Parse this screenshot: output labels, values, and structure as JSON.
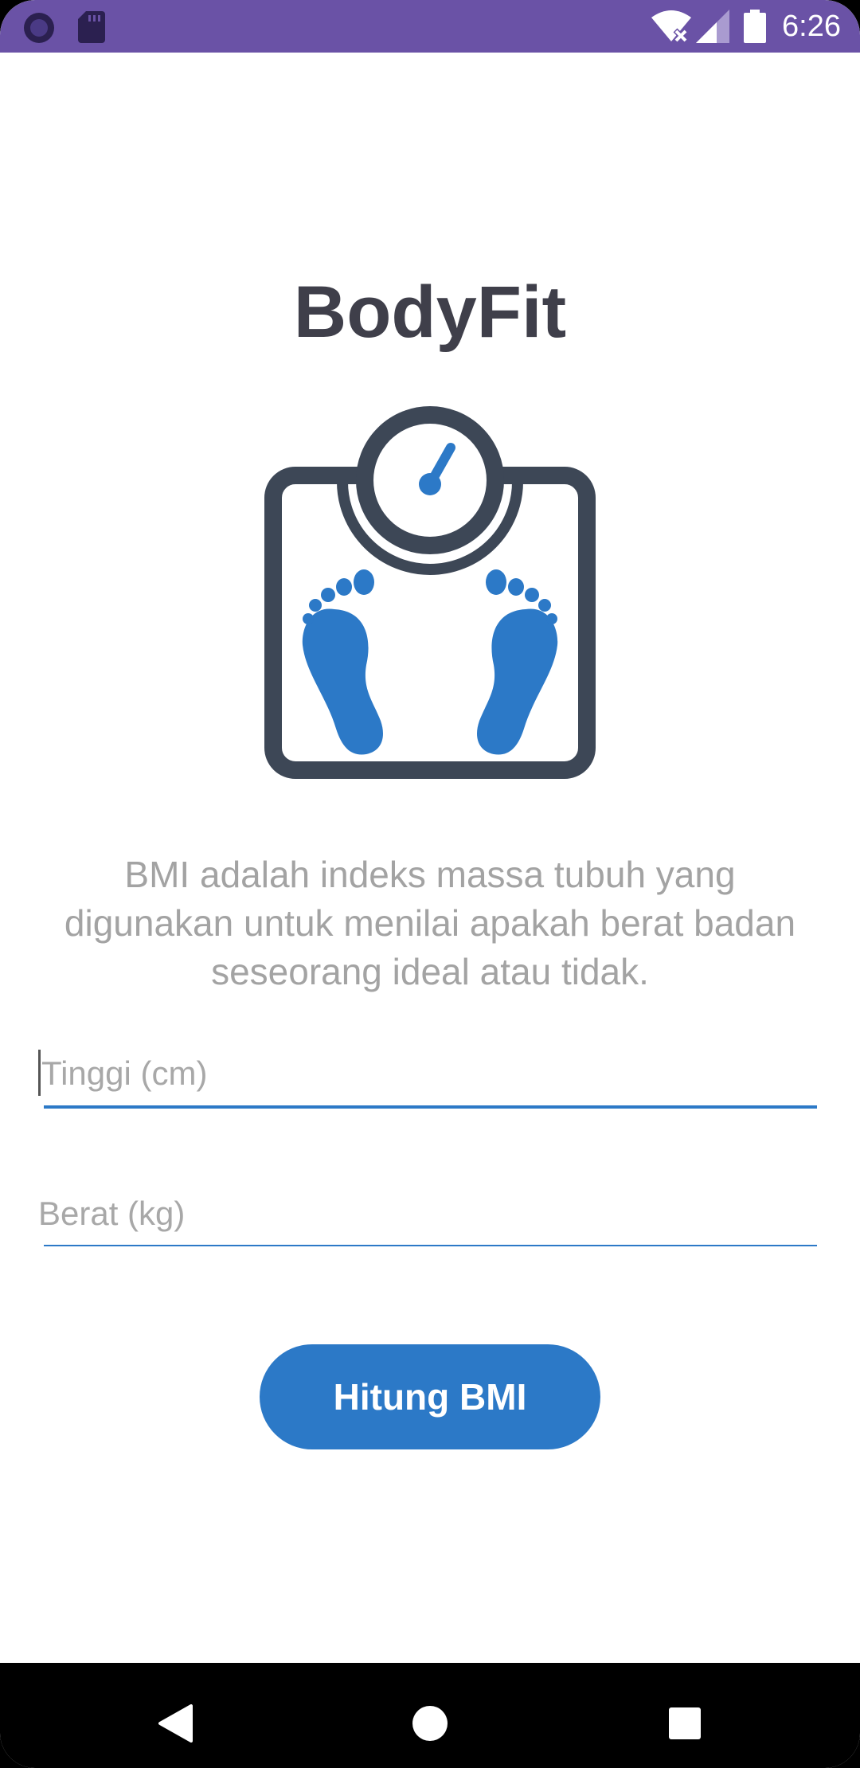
{
  "status_bar": {
    "time": "6:26",
    "background_color": "#6a52a6",
    "icons_left": [
      "circle-app-icon",
      "sd-card-icon"
    ],
    "icons_right": [
      "wifi-off-icon",
      "cell-signal-icon",
      "battery-icon"
    ]
  },
  "app": {
    "title": "BodyFit",
    "logo": "bathroom-scale-footprints-icon",
    "description": "BMI adalah indeks massa tubuh yang digunakan untuk menilai apakah berat badan seseorang ideal atau tidak.",
    "accent_color": "#2c79c7",
    "dark_color": "#3d4756"
  },
  "form": {
    "height_placeholder": "Tinggi (cm)",
    "height_value": "",
    "weight_placeholder": "Berat (kg)",
    "weight_value": "",
    "submit_label": "Hitung BMI"
  },
  "nav_bar": {
    "back": "back-triangle-icon",
    "home": "home-circle-icon",
    "recents": "recents-square-icon"
  }
}
